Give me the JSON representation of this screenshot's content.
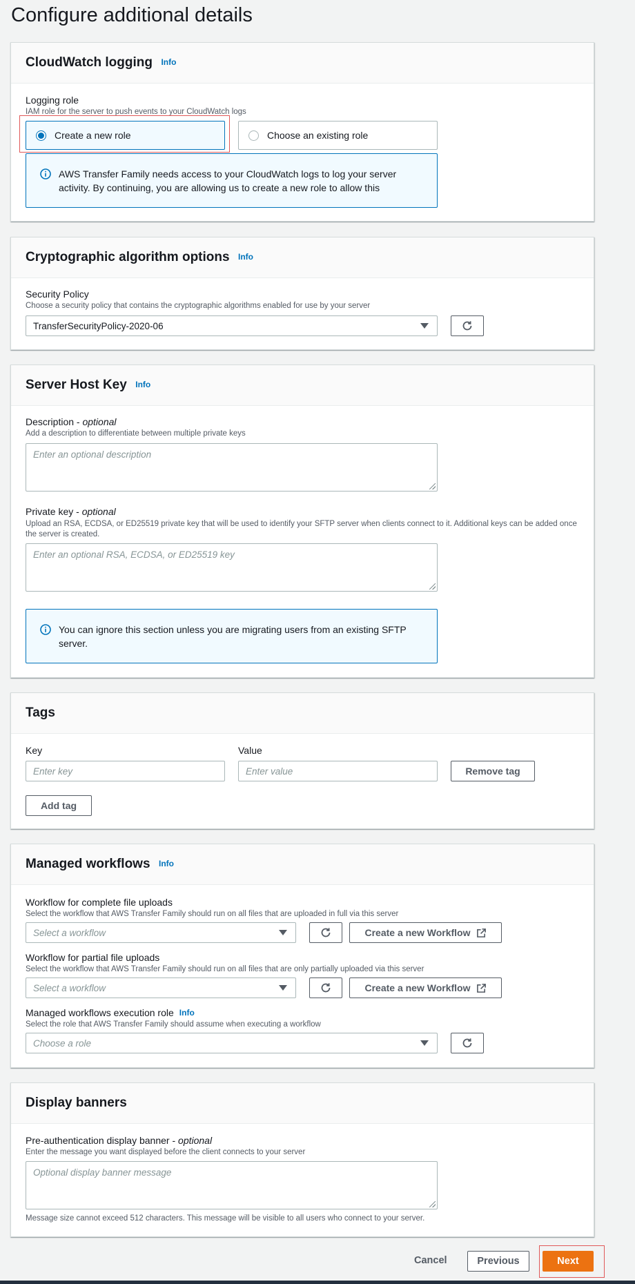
{
  "page": {
    "title": "Configure additional details"
  },
  "info_label": "Info",
  "cloudwatch": {
    "title": "CloudWatch logging",
    "role_label": "Logging role",
    "role_desc": "IAM role for the server to push events to your CloudWatch logs",
    "option_new": "Create a new role",
    "option_existing": "Choose an existing role",
    "alert_text": "AWS Transfer Family needs access to your CloudWatch logs to log your server activity. By continuing, you are allowing us to create a new role to allow this"
  },
  "crypto": {
    "title": "Cryptographic algorithm options",
    "policy_label": "Security Policy",
    "policy_desc": "Choose a security policy that contains the cryptographic algorithms enabled for use by your server",
    "policy_value": "TransferSecurityPolicy-2020-06"
  },
  "host_key": {
    "title": "Server Host Key",
    "description_label": "Description - ",
    "optional": "optional",
    "description_desc": "Add a description to differentiate between multiple private keys",
    "description_placeholder": "Enter an optional description",
    "private_key_label": "Private key - ",
    "private_key_desc": "Upload an RSA, ECDSA, or ED25519 private key that will be used to identify your SFTP server when clients connect to it. Additional keys can be added once the server is created.",
    "private_key_placeholder": "Enter an optional RSA, ECDSA, or ED25519 key",
    "alert_text": "You can ignore this section unless you are migrating users from an existing SFTP server."
  },
  "tags": {
    "title": "Tags",
    "key_label": "Key",
    "value_label": "Value",
    "key_placeholder": "Enter key",
    "value_placeholder": "Enter value",
    "remove_label": "Remove tag",
    "add_label": "Add tag"
  },
  "workflows": {
    "title": "Managed workflows",
    "complete_label": "Workflow for complete file uploads",
    "complete_desc": "Select the workflow that AWS Transfer Family should run on all files that are uploaded in full via this server",
    "select_placeholder": "Select a workflow",
    "create_label": "Create a new Workflow",
    "partial_label": "Workflow for partial file uploads",
    "partial_desc": "Select the workflow that AWS Transfer Family should run on all files that are only partially uploaded via this server",
    "role_label": "Managed workflows execution role",
    "role_desc": "Select the role that AWS Transfer Family should assume when executing a workflow",
    "role_placeholder": "Choose a role"
  },
  "banners": {
    "title": "Display banners",
    "pre_auth_label": "Pre-authentication display banner - ",
    "optional": "optional",
    "pre_auth_desc": "Enter the message you want displayed before the client connects to your server",
    "pre_auth_placeholder": "Optional display banner message",
    "constraint": "Message size cannot exceed 512 characters. This message will be visible to all users who connect to your server."
  },
  "footer": {
    "cancel": "Cancel",
    "previous": "Previous",
    "next": "Next"
  },
  "colors": {
    "accent": "#0073bb",
    "primary_button": "#ec7211",
    "highlight": "#e05858"
  },
  "icons": {
    "info": "info-circle-icon",
    "refresh": "refresh-icon",
    "external": "external-link-icon",
    "dropdown": "caret-down-icon"
  }
}
